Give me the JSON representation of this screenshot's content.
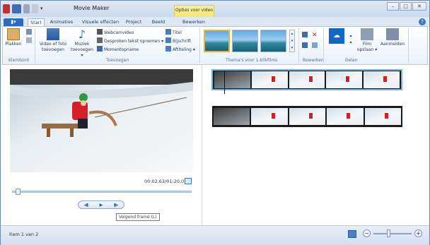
{
  "window": {
    "title": "Movie Maker",
    "context_tab": "Opties voor video",
    "buttons": [
      "–",
      "□",
      "✕"
    ]
  },
  "tabs": {
    "file": "▮▾",
    "items": [
      "Start",
      "Animaties",
      "Visuele effecten",
      "Project",
      "Beeld",
      "Bewerken"
    ],
    "active": "Start",
    "help": "?"
  },
  "ribbon": {
    "klembord": {
      "label": "Klembord",
      "paste": "Plakken"
    },
    "toevoegen": {
      "label": "Toevoegen",
      "add_video_line1": "Video of foto",
      "add_video_line2": "toevoegen",
      "add_music_line1": "Muziek",
      "add_music_line2": "toevoegen ▾",
      "webcam": "Webcamvideo",
      "narration": "Gesproken tekst opnemen ▾",
      "snapshot": "Momentopname",
      "title": "Titel",
      "caption": "Bijschrift",
      "credits": "Aftiteling ▾"
    },
    "themes": {
      "label": "Thema's voor 1-klikfilms"
    },
    "bewerken": {
      "label": "Bewerken"
    },
    "delen": {
      "label": "Delen",
      "save_line1": "Film",
      "save_line2": "opslaan ▾",
      "signin": "Aanmelden"
    }
  },
  "preview": {
    "time": "00:02,63/01:20,09"
  },
  "playback": {
    "prev": "◂▮",
    "play": "▶",
    "next": "▮▸",
    "tooltip": "Volgend frame (L)"
  },
  "status": {
    "text": "Item 1 van 2",
    "zoom_minus": "−",
    "zoom_plus": "+"
  },
  "colors": {
    "accent": "#2c6cbf",
    "context": "#f0e67a",
    "selection": "#6fb0e8"
  }
}
